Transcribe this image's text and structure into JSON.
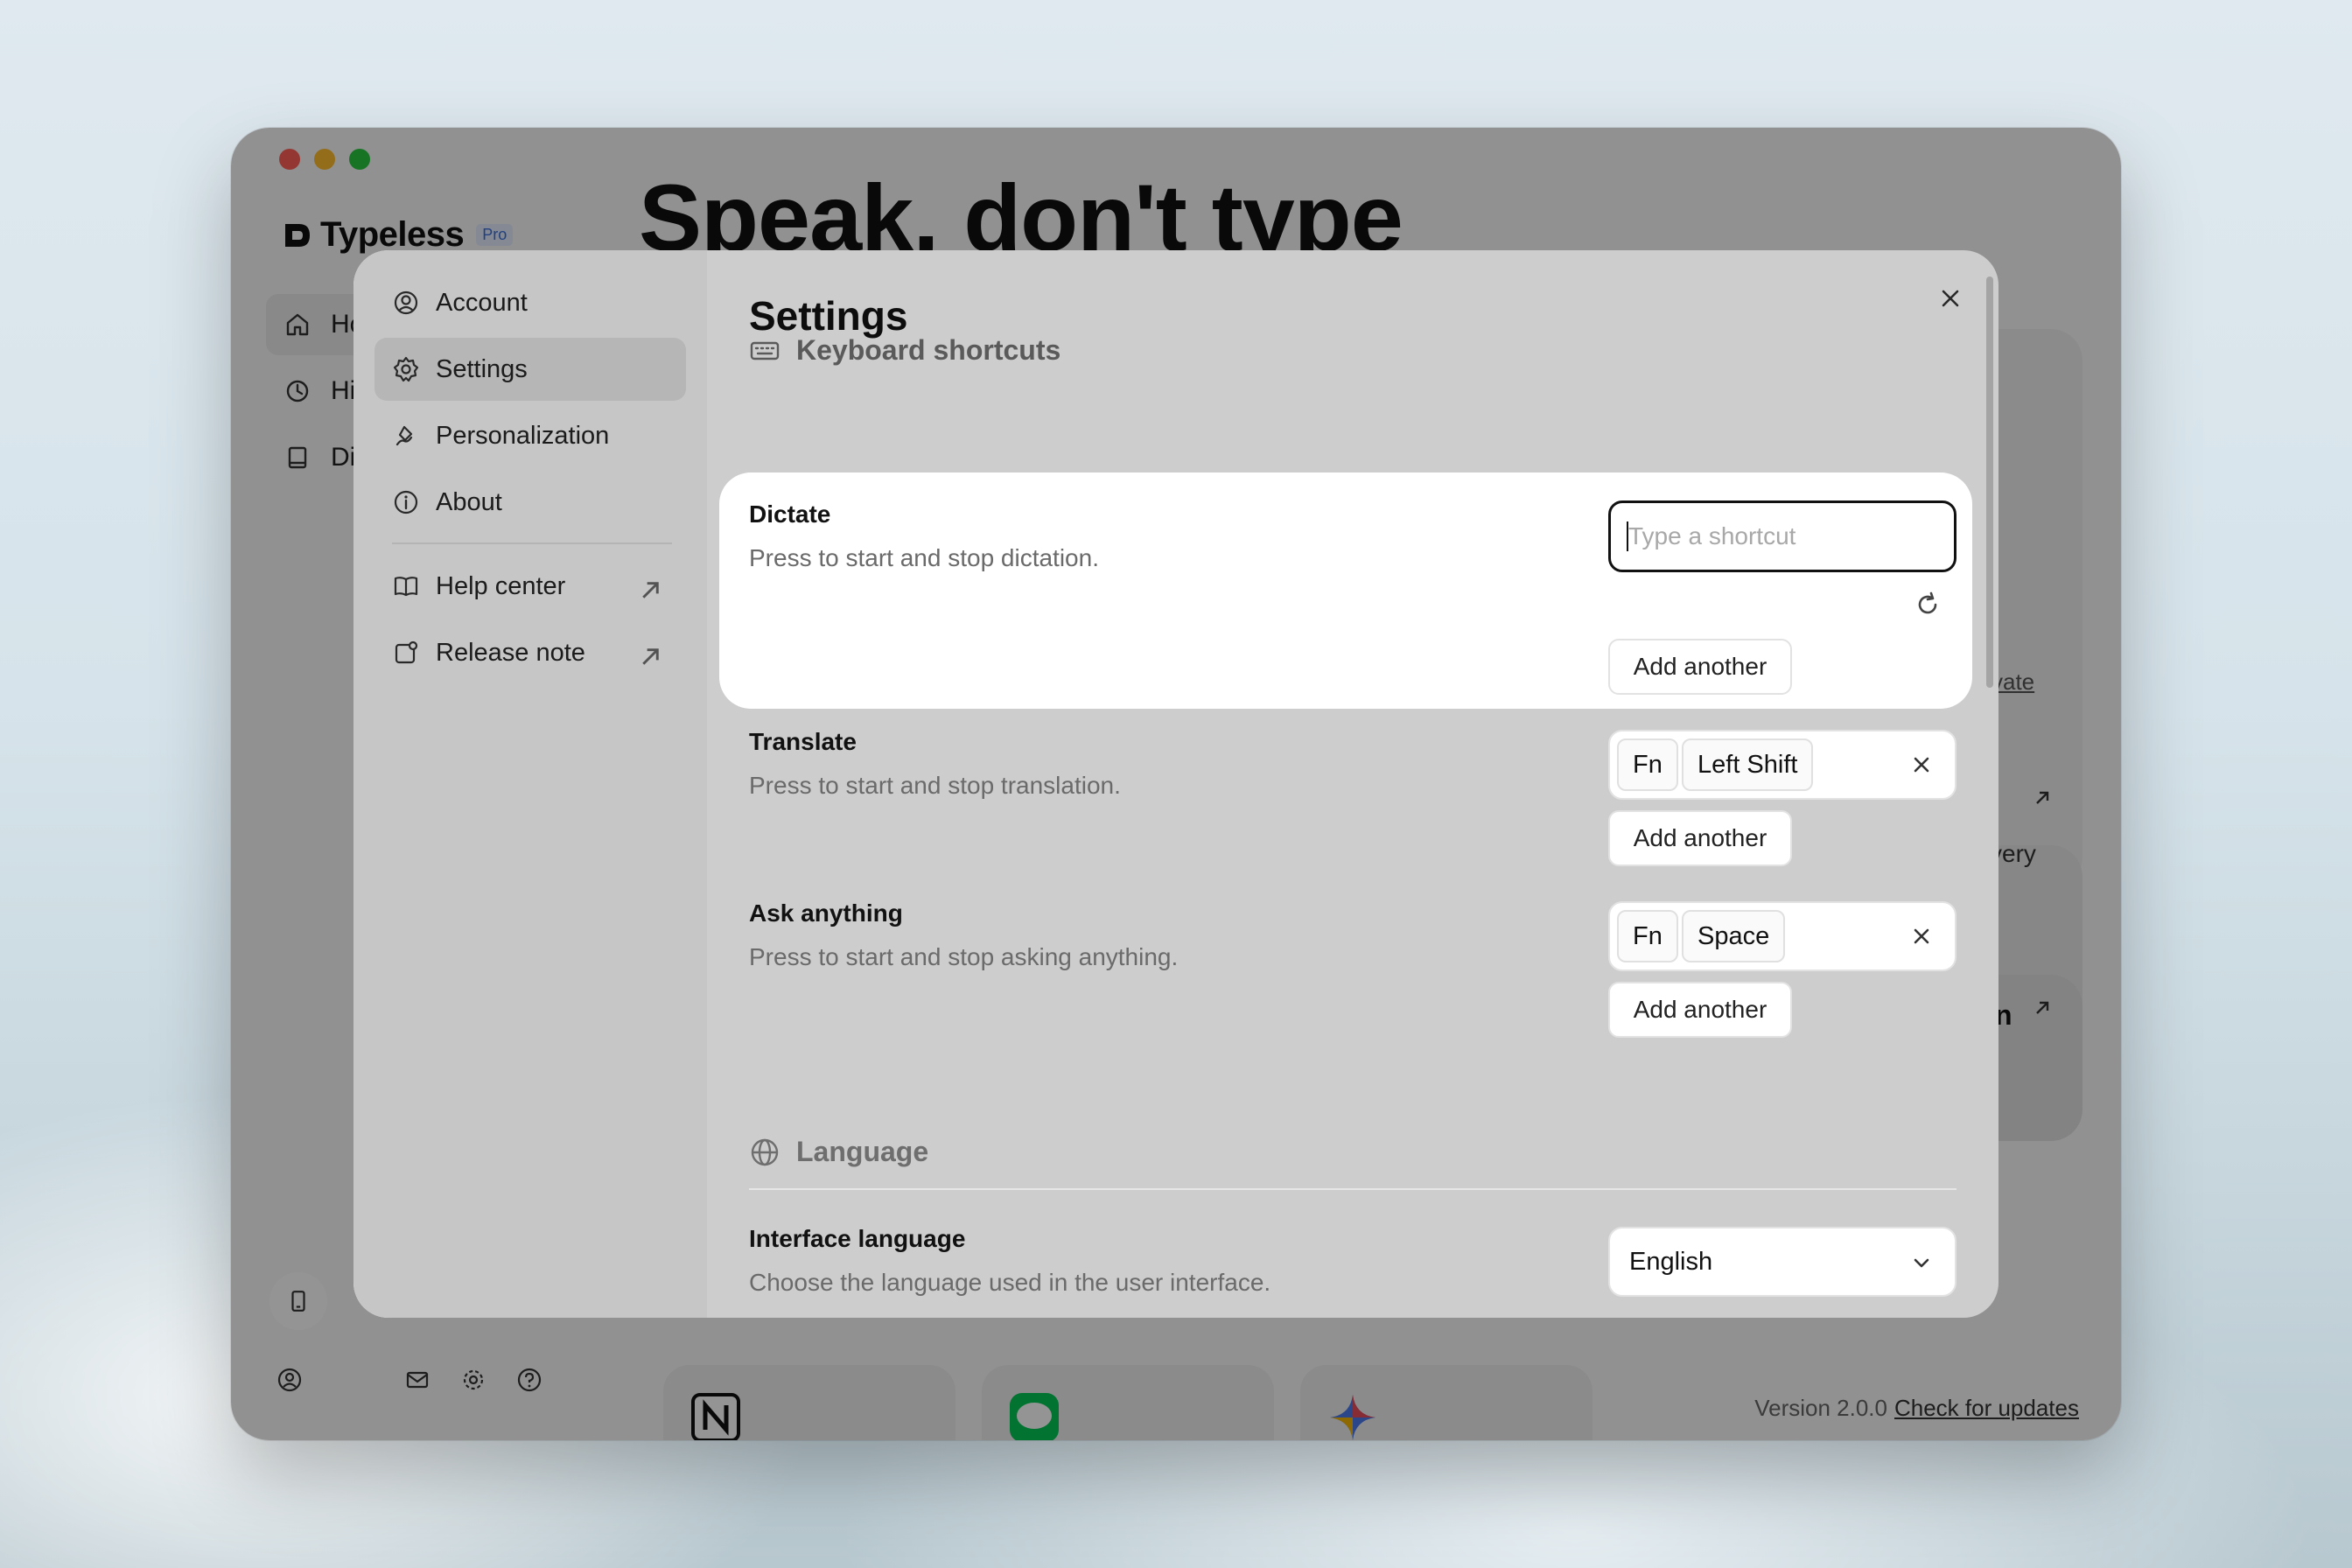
{
  "app": {
    "name": "Typeless",
    "badge": "Pro",
    "hero": "Speak, don't type",
    "nav": [
      {
        "label": "Ho",
        "icon": "home-icon"
      },
      {
        "label": "Hi",
        "icon": "history-icon"
      },
      {
        "label": "Di",
        "icon": "dictionary-icon"
      }
    ],
    "peek": {
      "link_fragment": "vate",
      "text_fragment": "very",
      "card_fragment": "n"
    },
    "version_label": "Version 2.0.0",
    "check_updates": "Check for updates"
  },
  "modal": {
    "sidebar": [
      {
        "label": "Account",
        "icon": "account-icon"
      },
      {
        "label": "Settings",
        "icon": "gear-icon",
        "active": true
      },
      {
        "label": "Personalization",
        "icon": "personalization-icon"
      },
      {
        "label": "About",
        "icon": "info-icon"
      }
    ],
    "links": [
      {
        "label": "Help center",
        "icon": "book-icon"
      },
      {
        "label": "Release note",
        "icon": "release-note-icon"
      }
    ],
    "title": "Settings",
    "keyboard_section": "Keyboard shortcuts",
    "shortcuts": {
      "dictate": {
        "title": "Dictate",
        "desc": "Press to start and stop dictation.",
        "placeholder": "Type a shortcut",
        "add": "Add another"
      },
      "translate": {
        "title": "Translate",
        "desc": "Press to start and stop translation.",
        "keys": [
          "Fn",
          "Left Shift"
        ],
        "add": "Add another"
      },
      "ask": {
        "title": "Ask anything",
        "desc": "Press to start and stop asking anything.",
        "keys": [
          "Fn",
          "Space"
        ],
        "add": "Add another"
      }
    },
    "language_section": "Language",
    "interface_language": {
      "title": "Interface language",
      "desc": "Choose the language used in the user interface.",
      "value": "English"
    }
  },
  "colors": {
    "accent": "#3b6fd8",
    "overlay": "rgba(0,0,0,0.42)"
  }
}
